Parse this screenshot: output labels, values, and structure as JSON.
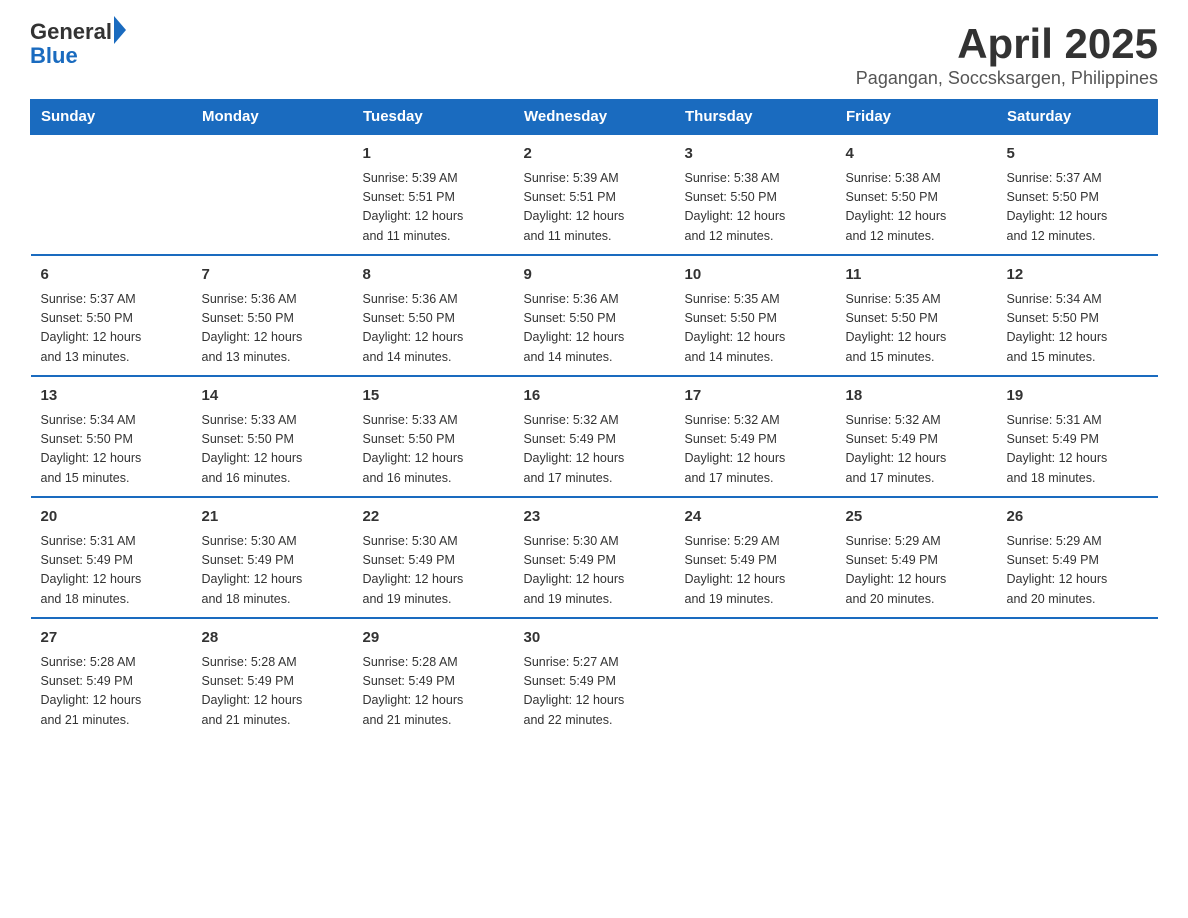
{
  "header": {
    "logo": {
      "general": "General",
      "blue": "Blue"
    },
    "month_year": "April 2025",
    "location": "Pagangan, Soccsksargen, Philippines"
  },
  "days_of_week": [
    "Sunday",
    "Monday",
    "Tuesday",
    "Wednesday",
    "Thursday",
    "Friday",
    "Saturday"
  ],
  "weeks": [
    [
      {
        "day": "",
        "info": ""
      },
      {
        "day": "",
        "info": ""
      },
      {
        "day": "1",
        "info": "Sunrise: 5:39 AM\nSunset: 5:51 PM\nDaylight: 12 hours\nand 11 minutes."
      },
      {
        "day": "2",
        "info": "Sunrise: 5:39 AM\nSunset: 5:51 PM\nDaylight: 12 hours\nand 11 minutes."
      },
      {
        "day": "3",
        "info": "Sunrise: 5:38 AM\nSunset: 5:50 PM\nDaylight: 12 hours\nand 12 minutes."
      },
      {
        "day": "4",
        "info": "Sunrise: 5:38 AM\nSunset: 5:50 PM\nDaylight: 12 hours\nand 12 minutes."
      },
      {
        "day": "5",
        "info": "Sunrise: 5:37 AM\nSunset: 5:50 PM\nDaylight: 12 hours\nand 12 minutes."
      }
    ],
    [
      {
        "day": "6",
        "info": "Sunrise: 5:37 AM\nSunset: 5:50 PM\nDaylight: 12 hours\nand 13 minutes."
      },
      {
        "day": "7",
        "info": "Sunrise: 5:36 AM\nSunset: 5:50 PM\nDaylight: 12 hours\nand 13 minutes."
      },
      {
        "day": "8",
        "info": "Sunrise: 5:36 AM\nSunset: 5:50 PM\nDaylight: 12 hours\nand 14 minutes."
      },
      {
        "day": "9",
        "info": "Sunrise: 5:36 AM\nSunset: 5:50 PM\nDaylight: 12 hours\nand 14 minutes."
      },
      {
        "day": "10",
        "info": "Sunrise: 5:35 AM\nSunset: 5:50 PM\nDaylight: 12 hours\nand 14 minutes."
      },
      {
        "day": "11",
        "info": "Sunrise: 5:35 AM\nSunset: 5:50 PM\nDaylight: 12 hours\nand 15 minutes."
      },
      {
        "day": "12",
        "info": "Sunrise: 5:34 AM\nSunset: 5:50 PM\nDaylight: 12 hours\nand 15 minutes."
      }
    ],
    [
      {
        "day": "13",
        "info": "Sunrise: 5:34 AM\nSunset: 5:50 PM\nDaylight: 12 hours\nand 15 minutes."
      },
      {
        "day": "14",
        "info": "Sunrise: 5:33 AM\nSunset: 5:50 PM\nDaylight: 12 hours\nand 16 minutes."
      },
      {
        "day": "15",
        "info": "Sunrise: 5:33 AM\nSunset: 5:50 PM\nDaylight: 12 hours\nand 16 minutes."
      },
      {
        "day": "16",
        "info": "Sunrise: 5:32 AM\nSunset: 5:49 PM\nDaylight: 12 hours\nand 17 minutes."
      },
      {
        "day": "17",
        "info": "Sunrise: 5:32 AM\nSunset: 5:49 PM\nDaylight: 12 hours\nand 17 minutes."
      },
      {
        "day": "18",
        "info": "Sunrise: 5:32 AM\nSunset: 5:49 PM\nDaylight: 12 hours\nand 17 minutes."
      },
      {
        "day": "19",
        "info": "Sunrise: 5:31 AM\nSunset: 5:49 PM\nDaylight: 12 hours\nand 18 minutes."
      }
    ],
    [
      {
        "day": "20",
        "info": "Sunrise: 5:31 AM\nSunset: 5:49 PM\nDaylight: 12 hours\nand 18 minutes."
      },
      {
        "day": "21",
        "info": "Sunrise: 5:30 AM\nSunset: 5:49 PM\nDaylight: 12 hours\nand 18 minutes."
      },
      {
        "day": "22",
        "info": "Sunrise: 5:30 AM\nSunset: 5:49 PM\nDaylight: 12 hours\nand 19 minutes."
      },
      {
        "day": "23",
        "info": "Sunrise: 5:30 AM\nSunset: 5:49 PM\nDaylight: 12 hours\nand 19 minutes."
      },
      {
        "day": "24",
        "info": "Sunrise: 5:29 AM\nSunset: 5:49 PM\nDaylight: 12 hours\nand 19 minutes."
      },
      {
        "day": "25",
        "info": "Sunrise: 5:29 AM\nSunset: 5:49 PM\nDaylight: 12 hours\nand 20 minutes."
      },
      {
        "day": "26",
        "info": "Sunrise: 5:29 AM\nSunset: 5:49 PM\nDaylight: 12 hours\nand 20 minutes."
      }
    ],
    [
      {
        "day": "27",
        "info": "Sunrise: 5:28 AM\nSunset: 5:49 PM\nDaylight: 12 hours\nand 21 minutes."
      },
      {
        "day": "28",
        "info": "Sunrise: 5:28 AM\nSunset: 5:49 PM\nDaylight: 12 hours\nand 21 minutes."
      },
      {
        "day": "29",
        "info": "Sunrise: 5:28 AM\nSunset: 5:49 PM\nDaylight: 12 hours\nand 21 minutes."
      },
      {
        "day": "30",
        "info": "Sunrise: 5:27 AM\nSunset: 5:49 PM\nDaylight: 12 hours\nand 22 minutes."
      },
      {
        "day": "",
        "info": ""
      },
      {
        "day": "",
        "info": ""
      },
      {
        "day": "",
        "info": ""
      }
    ]
  ]
}
